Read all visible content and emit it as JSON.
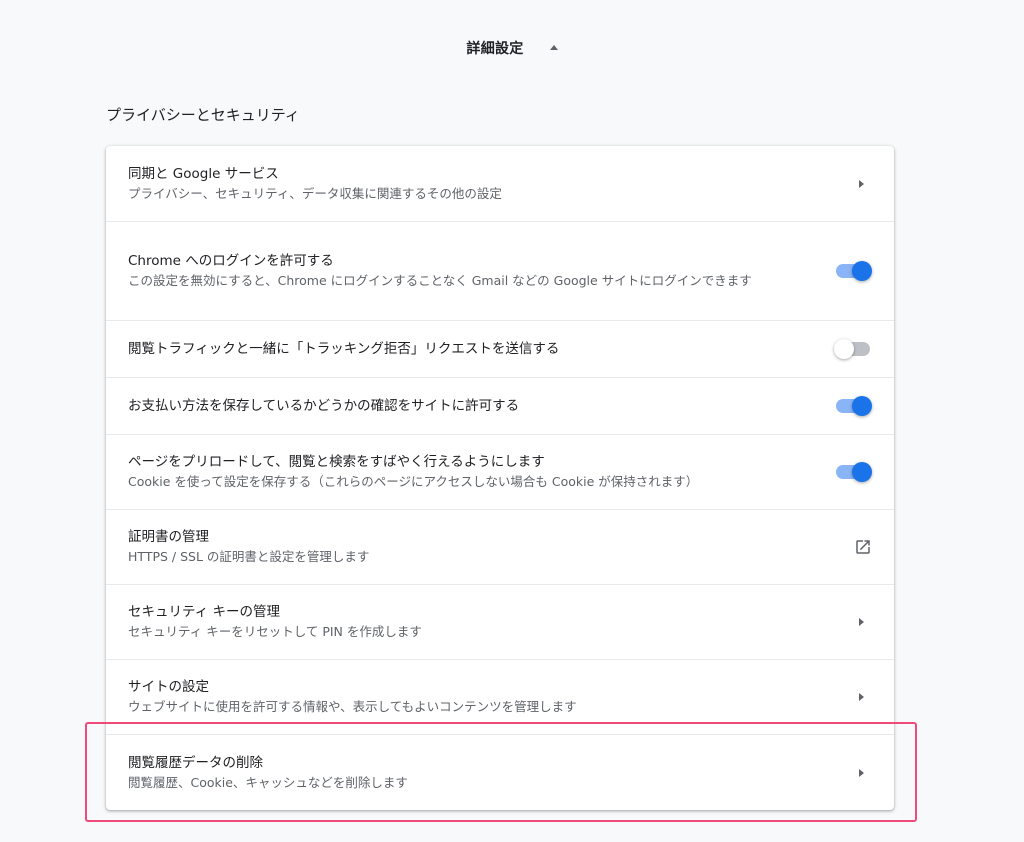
{
  "advanced": {
    "title": "詳細設定"
  },
  "section": {
    "title": "プライバシーとセキュリティ"
  },
  "rows": [
    {
      "label": "同期と Google サービス",
      "sub": "プライバシー、セキュリティ、データ収集に関連するその他の設定",
      "control": "arrow"
    },
    {
      "label": "Chrome へのログインを許可する",
      "sub": "この設定を無効にすると、Chrome にログインすることなく Gmail などの Google サイトにログインできます",
      "control": "toggle",
      "state": "on"
    },
    {
      "label": "閲覧トラフィックと一緒に「トラッキング拒否」リクエストを送信する",
      "control": "toggle",
      "state": "off"
    },
    {
      "label": "お支払い方法を保存しているかどうかの確認をサイトに許可する",
      "control": "toggle",
      "state": "on"
    },
    {
      "label": "ページをプリロードして、閲覧と検索をすばやく行えるようにします",
      "sub": "Cookie を使って設定を保存する（これらのページにアクセスしない場合も Cookie が保持されます）",
      "control": "toggle",
      "state": "on"
    },
    {
      "label": "証明書の管理",
      "sub": "HTTPS / SSL の証明書と設定を管理します",
      "control": "external-link"
    },
    {
      "label": "セキュリティ キーの管理",
      "sub": "セキュリティ キーをリセットして PIN を作成します",
      "control": "arrow"
    },
    {
      "label": "サイトの設定",
      "sub": "ウェブサイトに使用を許可する情報や、表示してもよいコンテンツを管理します",
      "control": "arrow"
    },
    {
      "label": "閲覧履歴データの削除",
      "sub": "閲覧履歴、Cookie、キャッシュなどを削除します",
      "control": "arrow",
      "highlighted": true
    }
  ],
  "colors": {
    "accent": "#1a73e8",
    "accent_track": "#8ab4f8",
    "highlight": "#ef4b7a"
  }
}
